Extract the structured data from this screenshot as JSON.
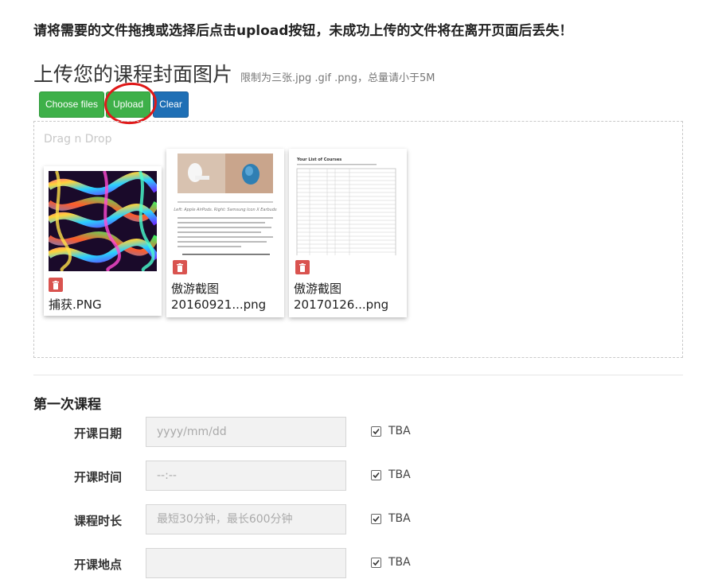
{
  "notice": "请将需要的文件拖拽或选择后点击upload按钮，未成功上传的文件将在离开页面后丢失！",
  "upload_section": {
    "title": "上传您的课程封面图片",
    "hint": "限制为三张.jpg .gif .png，总量请小于5M"
  },
  "buttons": {
    "choose": "Choose files",
    "upload": "Upload",
    "clear": "Clear"
  },
  "dropzone": {
    "label": "Drag n Drop",
    "files": [
      {
        "name": "捕获.PNG",
        "name2": ""
      },
      {
        "name": "傲游截图",
        "name2": "20160921...png"
      },
      {
        "name": "傲游截图",
        "name2": "20170126...png"
      }
    ],
    "preview_caption": "Left: Apple AirPods. Right: Samsung Icon X Earbuds",
    "doc_title": "Your List of Courses"
  },
  "course_section": {
    "title": "第一次课程",
    "rows": [
      {
        "label": "开课日期",
        "placeholder": "yyyy/mm/dd",
        "tba": "TBA"
      },
      {
        "label": "开课时间",
        "placeholder": "--:--",
        "tba": "TBA"
      },
      {
        "label": "课程时长",
        "placeholder": "最短30分钟，最长600分钟",
        "tba": "TBA"
      },
      {
        "label": "开课地点",
        "placeholder": "",
        "tba": "TBA"
      }
    ]
  },
  "colors": {
    "green": "#3eb049",
    "blue": "#1f6fb5",
    "red": "#d9534f",
    "annotation": "#e01818"
  }
}
